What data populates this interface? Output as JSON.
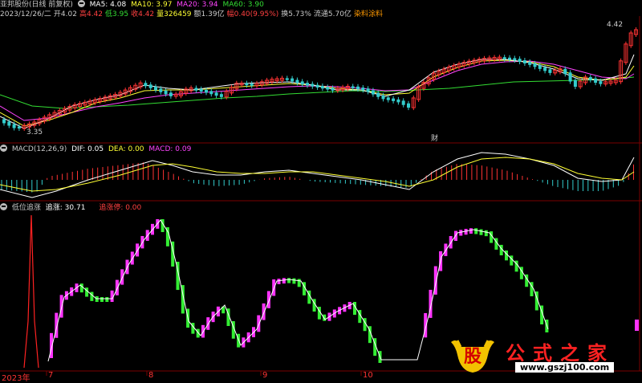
{
  "header": {
    "stock_name": "亚邦股份(日线 前复权)",
    "ma": [
      {
        "label": "MA5: 4.08",
        "color": "#ffffff"
      },
      {
        "label": "MA10: 3.97",
        "color": "#ffff33"
      },
      {
        "label": "MA20: 3.94",
        "color": "#ff44ff"
      },
      {
        "label": "MA60: 3.90",
        "color": "#33dd33"
      }
    ]
  },
  "quote": {
    "date": "2023/12/26/二",
    "open_label": "开",
    "open": "4.02",
    "high_label": "高",
    "high": "4.42",
    "low_label": "低",
    "low": "3.95",
    "close_label": "收",
    "close": "4.42",
    "volume_label": "量",
    "volume": "326459",
    "amount_label": "额",
    "amount": "1.39亿",
    "change_label": "幅",
    "change": "0.40(9.95%)",
    "turnover_label": "换",
    "turnover": "5.73%",
    "float_label": "流通",
    "float": "5.70亿",
    "concept": "染料涂料"
  },
  "price_chart": {
    "high_label": "4.42",
    "low_label": "3.35",
    "event_label": "财",
    "colors": {
      "up": "#ff3333",
      "down": "#33cccc",
      "ma5": "#ffffff",
      "ma10": "#ffff33",
      "ma20": "#ff44ff",
      "ma60": "#33dd33"
    }
  },
  "macd_panel": {
    "title": "MACD(12,26,9)",
    "dif": "DIF: 0.05",
    "dea": "DEA: 0.00",
    "macd": "MACD: 0.09"
  },
  "indicator_panel": {
    "title": "低位追涨",
    "value_label": "追涨: 30.71",
    "stop_label": "追涨停: 0.00"
  },
  "x_axis": {
    "labels": [
      "2023年",
      "7",
      "8",
      "9",
      "10"
    ]
  },
  "watermark": {
    "brand": "股",
    "name": "公式之家",
    "url": "www.gszj100.com"
  }
}
